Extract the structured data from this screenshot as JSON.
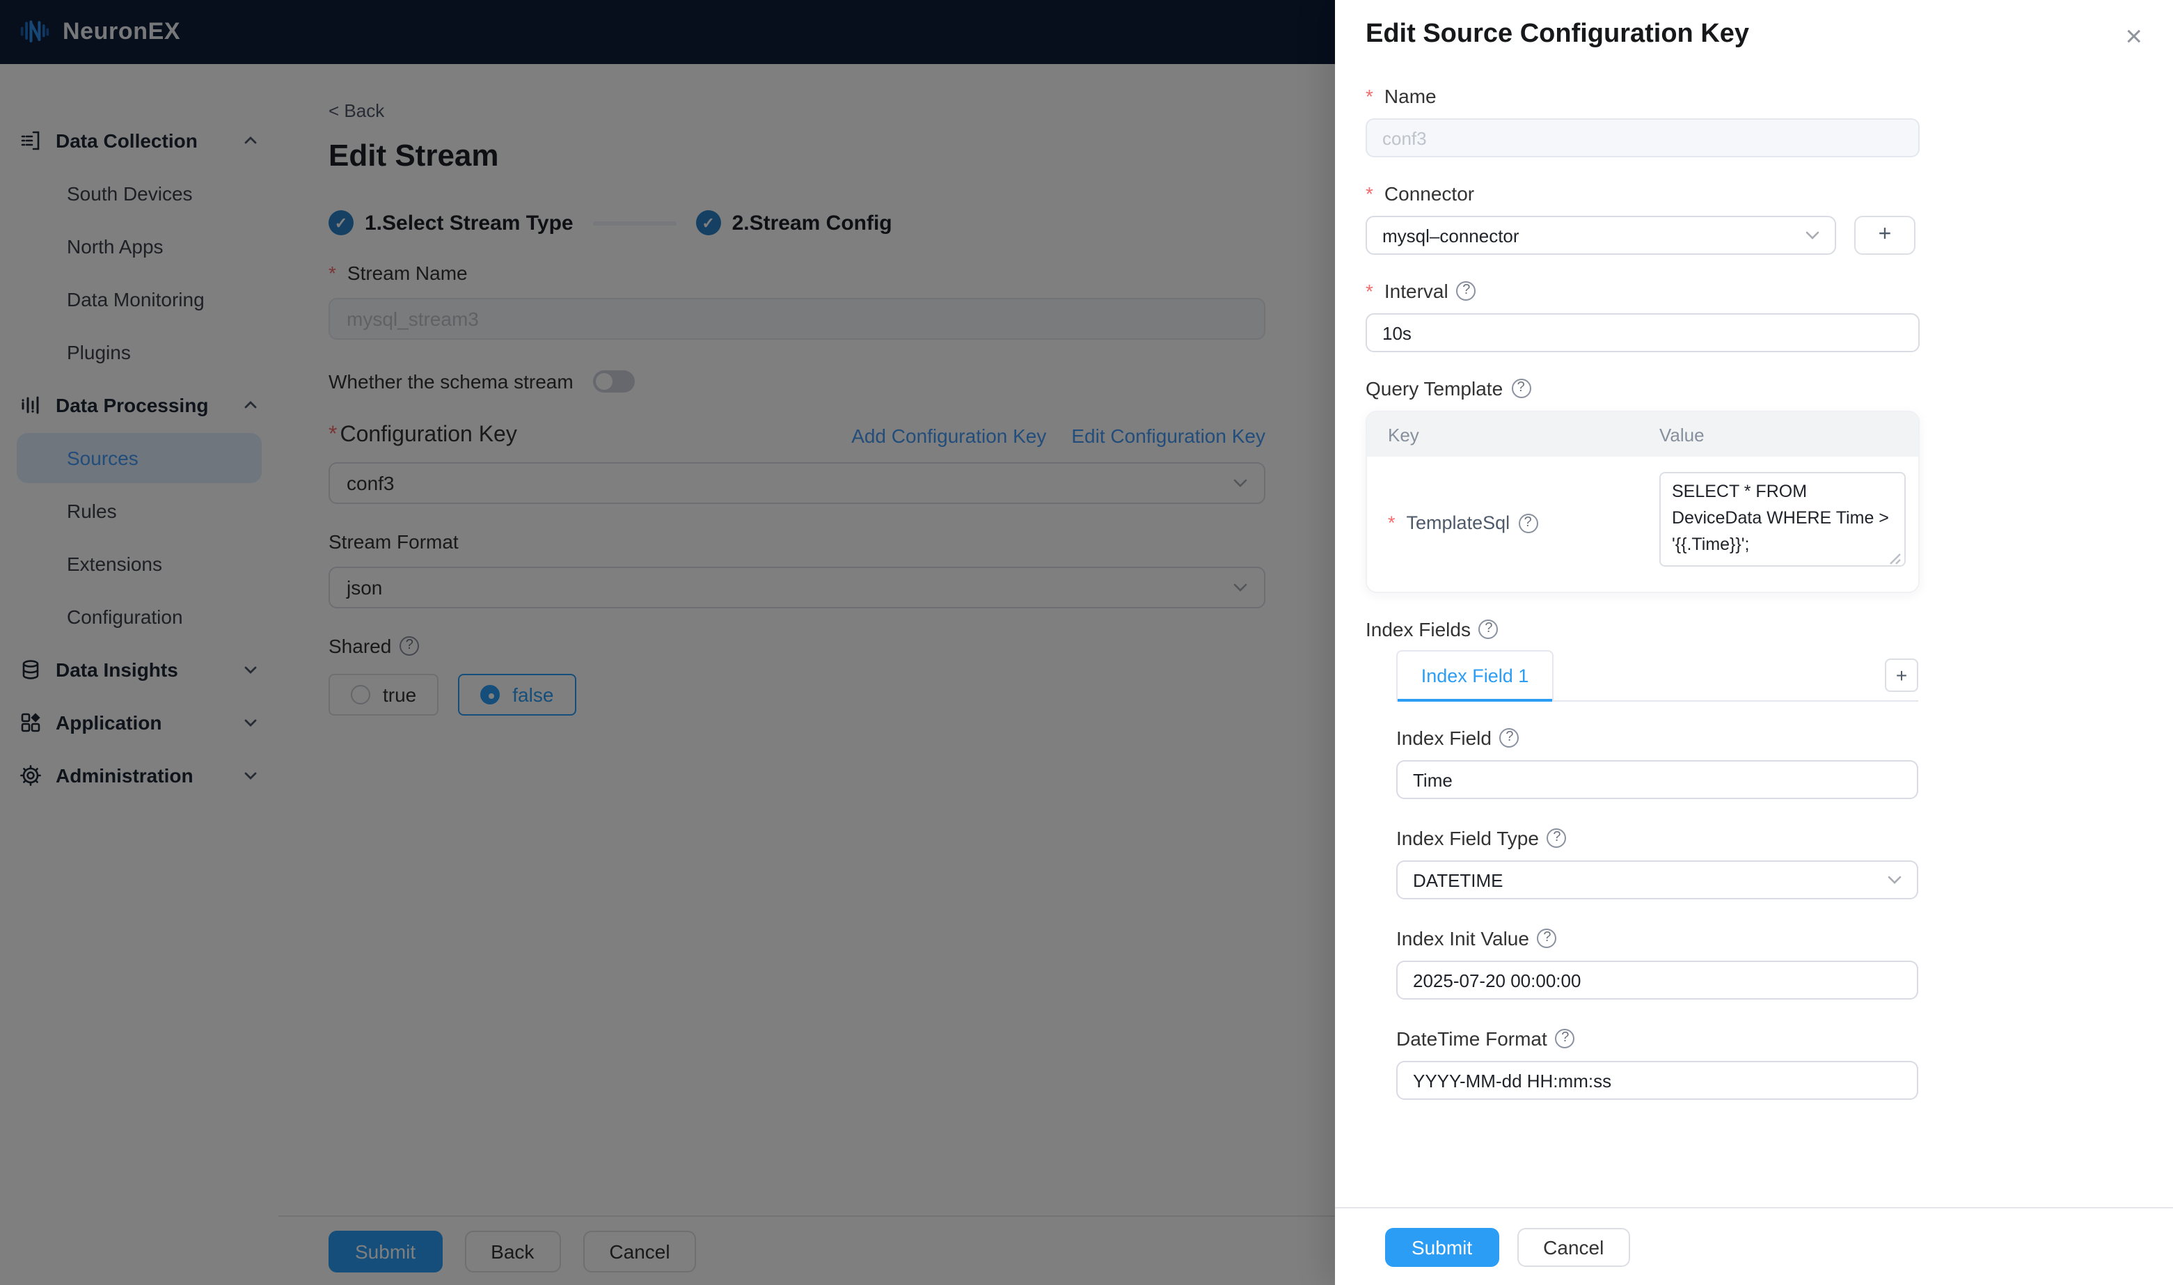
{
  "icons": {
    "help": "?",
    "close": "×",
    "plus": "+",
    "check": "✓",
    "required": "*"
  },
  "header": {
    "brand": "NeuronEX"
  },
  "sidebar": {
    "groups": [
      {
        "label": "Data Collection"
      },
      {
        "label": "Data Processing"
      },
      {
        "label": "Data Insights"
      },
      {
        "label": "Application"
      },
      {
        "label": "Administration"
      }
    ],
    "collection_items": [
      {
        "label": "South Devices"
      },
      {
        "label": "North Apps"
      },
      {
        "label": "Data Monitoring"
      },
      {
        "label": "Plugins"
      }
    ],
    "processing_items": [
      {
        "label": "Sources",
        "active": true
      },
      {
        "label": "Rules"
      },
      {
        "label": "Extensions"
      },
      {
        "label": "Configuration"
      }
    ]
  },
  "main": {
    "back": "< Back",
    "title": "Edit Stream",
    "steps": [
      {
        "label": "1.Select Stream Type"
      },
      {
        "label": "2.Stream Config"
      }
    ],
    "fields": {
      "stream_name": {
        "label": "Stream Name",
        "value": "mysql_stream3"
      },
      "schema_toggle": {
        "label": "Whether the schema stream",
        "on": false
      },
      "configuration_key": {
        "label": "Configuration Key",
        "value": "conf3",
        "links": [
          "Add Configuration Key",
          "Edit Configuration Key"
        ]
      },
      "stream_format": {
        "label": "Stream Format",
        "value": "json"
      },
      "shared": {
        "label": "Shared",
        "options": [
          "true",
          "false"
        ],
        "selected": "false"
      }
    },
    "footer": {
      "submit": "Submit",
      "back": "Back",
      "cancel": "Cancel"
    }
  },
  "drawer": {
    "title": "Edit Source Configuration Key",
    "fields": {
      "name": {
        "label": "Name",
        "value": "conf3"
      },
      "connector": {
        "label": "Connector",
        "value": "mysql–connector"
      },
      "interval": {
        "label": "Interval",
        "value": "10s"
      },
      "query_template": {
        "label": "Query Template",
        "columns": [
          "Key",
          "Value"
        ],
        "rows": [
          {
            "key": "TemplateSql",
            "value": "SELECT * FROM DeviceData WHERE Time > '{{.Time}}';"
          }
        ]
      },
      "index_fields": {
        "label": "Index Fields",
        "tabs": [
          {
            "label": "Index Field 1",
            "active": true
          }
        ],
        "index_field": {
          "label": "Index Field",
          "value": "Time"
        },
        "index_field_type": {
          "label": "Index Field Type",
          "value": "DATETIME"
        },
        "index_init_value": {
          "label": "Index Init Value",
          "value": "2025-07-20 00:00:00"
        },
        "datetime_format": {
          "label": "DateTime Format",
          "value": "YYYY-MM-dd HH:mm:ss"
        }
      }
    },
    "footer": {
      "submit": "Submit",
      "cancel": "Cancel"
    },
    "colors": {
      "primary": "#2b9df4",
      "link": "#459bf7",
      "topbar": "#0f1c38",
      "danger": "#f56c6c"
    }
  }
}
